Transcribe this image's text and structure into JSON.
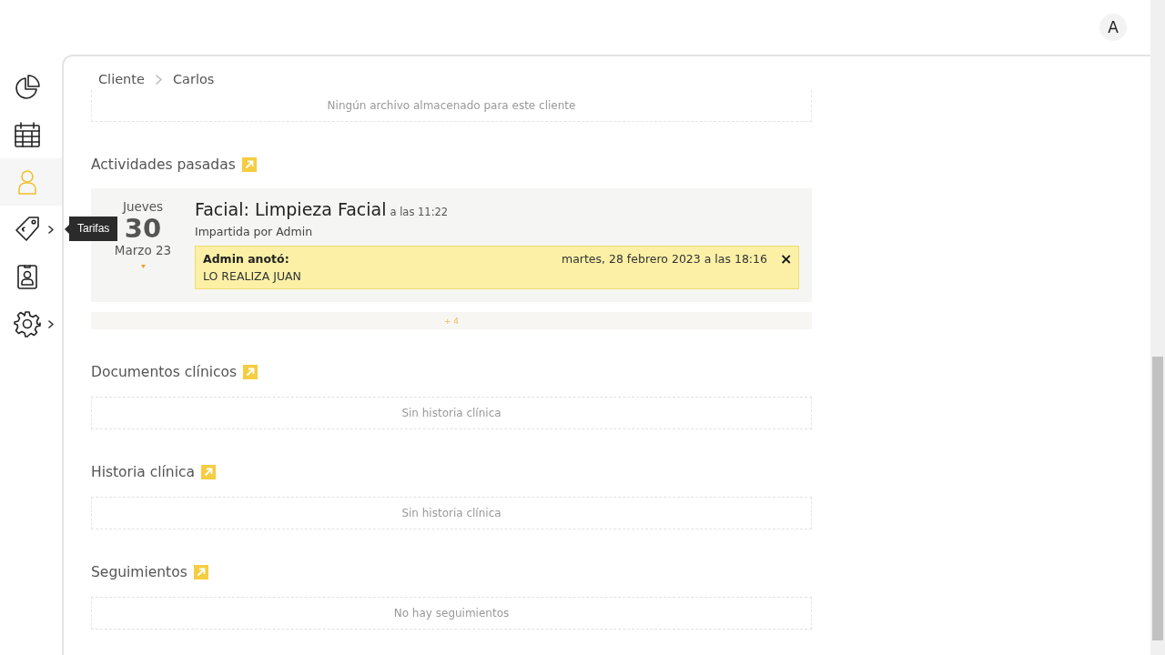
{
  "header": {
    "avatar": "A"
  },
  "sidebar": {
    "items": [
      {
        "selected": false,
        "submenu": false
      },
      {
        "selected": false,
        "submenu": false
      },
      {
        "selected": true,
        "submenu": false
      },
      {
        "selected": false,
        "submenu": true,
        "tooltip": "Tarifas"
      },
      {
        "selected": false,
        "submenu": false
      },
      {
        "selected": false,
        "submenu": true
      }
    ]
  },
  "breadcrumb": [
    "Cliente",
    "Carlos"
  ],
  "files": {
    "empty": "Ningún archivo almacenado para este cliente"
  },
  "sections": [
    {
      "kind": "activities",
      "title": "Actividades pasadas",
      "activities": [
        {
          "weekday": "Jueves",
          "day": "30",
          "month": "Marzo 23",
          "title": "Facial: Limpieza Facial",
          "time": "a las 11:22",
          "by": "Impartida por Admin",
          "note": {
            "author": "Admin anotó:",
            "date": "martes, 28 febrero 2023 a las 18:16",
            "close": "×",
            "text": "LO REALIZA JUAN"
          }
        }
      ],
      "more": "+ 4"
    },
    {
      "kind": "empty",
      "title": "Documentos clínicos",
      "empty": "Sin historia clínica"
    },
    {
      "kind": "empty",
      "title": "Historia clínica",
      "empty": "Sin historia clínica"
    },
    {
      "kind": "empty",
      "title": "Seguimientos",
      "empty": "No hay seguimientos"
    }
  ]
}
